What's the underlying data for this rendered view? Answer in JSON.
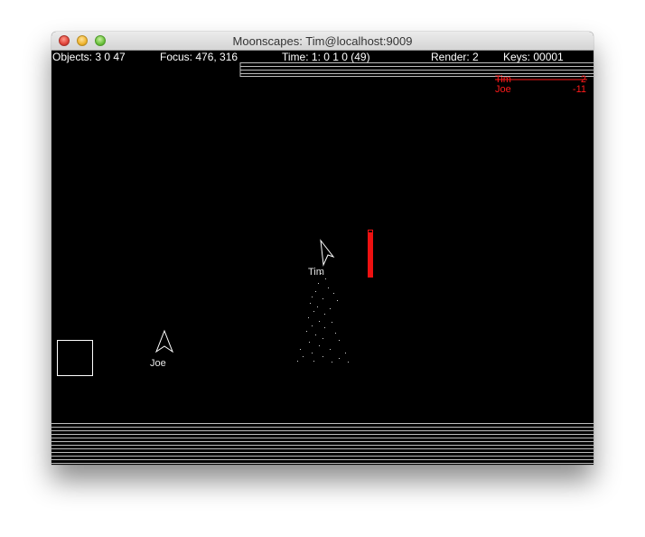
{
  "window": {
    "title": "Moonscapes: Tim@localhost:9009"
  },
  "hud": {
    "objects": "Objects: 3 0 47",
    "focus": "Focus: 476, 316",
    "time": "Time: 1: 0 1 0 (49)",
    "render": "Render: 2",
    "keys": "Keys: 00001"
  },
  "scoreboard": [
    {
      "name": "Tim",
      "score": "-2"
    },
    {
      "name": "Joe",
      "score": "-11"
    }
  ],
  "players": {
    "self": {
      "name": "Tim",
      "health": 1.0
    },
    "other": {
      "name": "Joe"
    }
  },
  "colors": {
    "background": "#000000",
    "foreground": "#ffffff",
    "scoreboard": "#ff1a1a",
    "health_bar": "#ee1111"
  }
}
